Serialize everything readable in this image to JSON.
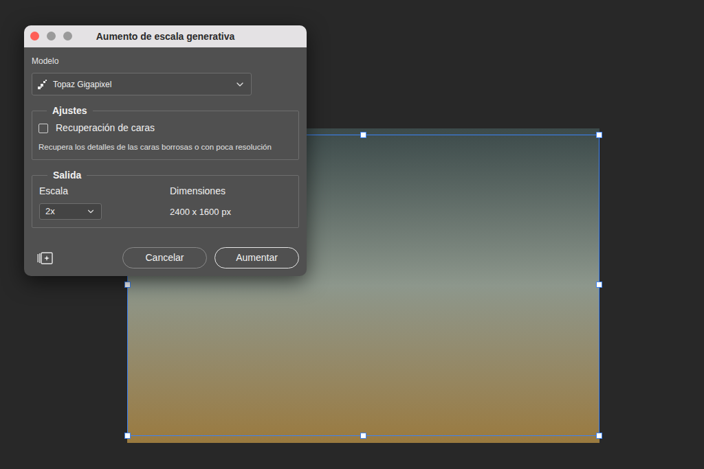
{
  "window": {
    "title": "Aumento de escala generativa"
  },
  "model": {
    "label": "Modelo",
    "value": "Topaz Gigapixel"
  },
  "settings": {
    "legend": "Ajustes",
    "face_recovery": {
      "label": "Recuperación de caras",
      "checked": false
    },
    "description": "Recupera los detalles de las caras borrosas o con poca resolución"
  },
  "output": {
    "legend": "Salida",
    "scale": {
      "label": "Escala",
      "value": "2x"
    },
    "dimensions": {
      "label": "Dimensiones",
      "value": "2400 x 1600 px"
    }
  },
  "buttons": [
    {
      "label": "Cancelar",
      "primary": false
    },
    {
      "label": "Aumentar",
      "primary": true
    }
  ]
}
